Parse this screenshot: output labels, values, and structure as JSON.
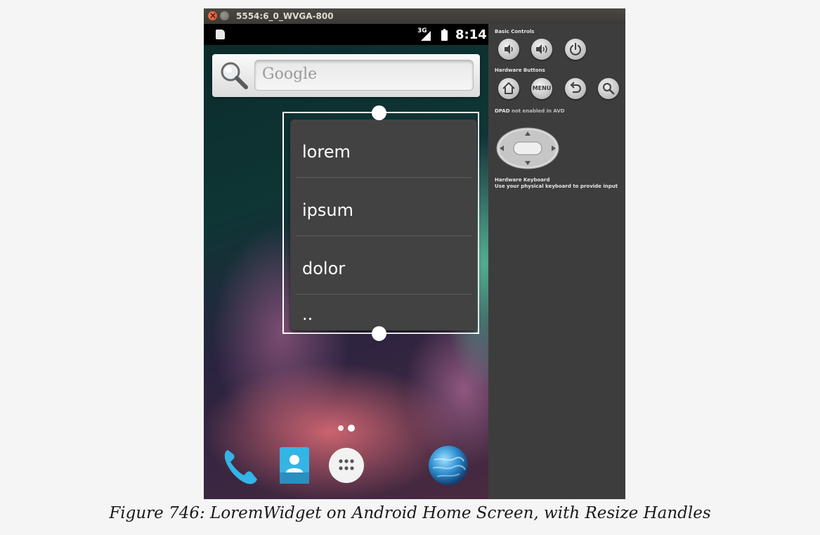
{
  "window": {
    "title": "5554:6_0_WVGA-800"
  },
  "statusbar": {
    "network_type": "3G",
    "time": "8:14"
  },
  "search_widget": {
    "placeholder": "Google"
  },
  "lorem_widget": {
    "items": [
      "lorem",
      "ipsum",
      "dolor",
      ".."
    ]
  },
  "dock": {
    "icons": [
      "phone-icon",
      "contacts-icon",
      "app-drawer-icon",
      "browser-icon"
    ]
  },
  "controls": {
    "basic_controls_label": "Basic Controls",
    "hardware_buttons_label": "Hardware Buttons",
    "menu_label": "MENU",
    "dpad_label": "DPAD",
    "dpad_note": "not enabled in AVD",
    "keyboard_title": "Hardware Keyboard",
    "keyboard_note": "Use your physical keyboard to provide input"
  },
  "caption": "Figure 746: LoremWidget on Android Home Screen, with Resize Handles"
}
